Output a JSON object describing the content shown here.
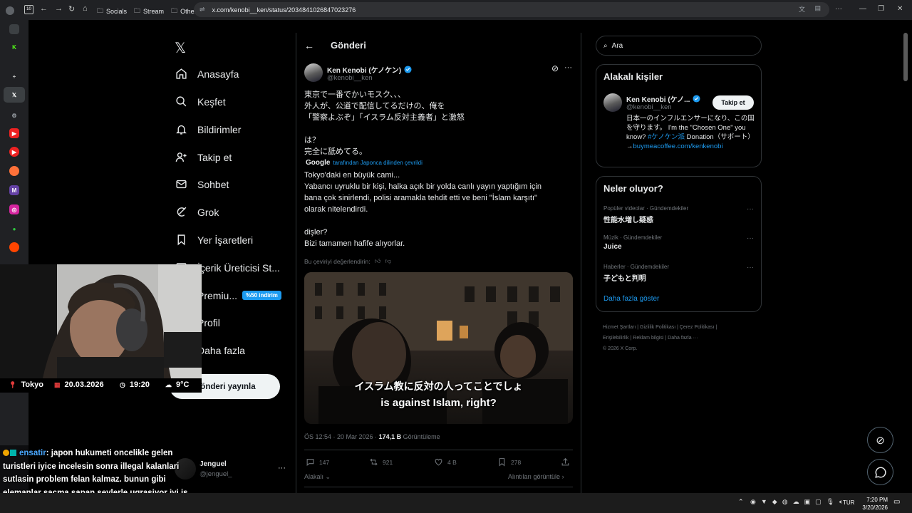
{
  "browser": {
    "tab_count": "10",
    "bookmarks": [
      "Socials",
      "Stream",
      "Others"
    ],
    "url": "x.com/kenobi__ken/status/2034841026847023276"
  },
  "sidebar": {
    "items": [
      {
        "label": "Anasayfa",
        "icon": "home-icon"
      },
      {
        "label": "Keşfet",
        "icon": "search-icon"
      },
      {
        "label": "Bildirimler",
        "icon": "bell-icon"
      },
      {
        "label": "Takip et",
        "icon": "person-add-icon"
      },
      {
        "label": "Sohbet",
        "icon": "mail-icon"
      },
      {
        "label": "Grok",
        "icon": "grok-icon"
      },
      {
        "label": "Yer İşaretleri",
        "icon": "bookmark-icon"
      },
      {
        "label": "İçerik Üreticisi St...",
        "icon": "studio-icon"
      },
      {
        "label": "Premiu...",
        "icon": "premium-icon"
      },
      {
        "label": "Profil",
        "icon": "profile-icon"
      },
      {
        "label": "Daha fazla",
        "icon": "more-icon"
      }
    ],
    "premium_badge": "%50 indirim",
    "post_button": "Gönderi yayınla",
    "account": {
      "name": "Jenguel",
      "handle": "@jenguel_"
    }
  },
  "main": {
    "header_title": "Gönderi",
    "tweet": {
      "author_name": "Ken Kenobi (ケノケン)",
      "author_handle": "@kenobi__ken",
      "original_lines": [
        "東京で一番でかいモスク、、、",
        "外人が、公道で配信してるだけの、俺を",
        "「警察よぶぞ」「イスラム反対主義者」と激怒",
        "",
        "は？",
        "完全に舐めてる。"
      ],
      "translation_provider": "Google",
      "translation_note": "tarafından Japonca dilinden çevrildi",
      "translated_lines": [
        "Tokyo'daki en büyük cami...",
        "Yabancı uyruklu bir kişi, halka açık bir yolda canlı yayın yaptığım için",
        "bana çok sinirlendi, polisi aramakla tehdit etti ve beni \"İslam karşıtı\"",
        "olarak nitelendirdi.",
        "",
        "dişler?",
        "Bizi tamamen hafife alıyorlar."
      ],
      "rate_translation": "Bu çeviriyi değerlendirin:",
      "video_caption_jp": "イスラム教に反対の人ってことでしょ",
      "video_caption_en": "is against Islam, right?",
      "time": "ÖS 12:54 · 20 Mar 2026 · ",
      "views": "174,1 B",
      "views_label": " Görüntüleme",
      "stats": {
        "replies": "147",
        "reposts": "921",
        "likes": "4 B",
        "bookmarks": "278"
      },
      "reply_setting": "Alakalı",
      "quotes_link": "Alıntıları görüntüle"
    }
  },
  "right": {
    "search_placeholder": "Ara",
    "related_title": "Alakalı kişiler",
    "related": {
      "name": "Ken Kenobi (ケノ...",
      "handle": "@kenobi__ken",
      "follow": "Takip et",
      "bio_1": "日本一のインフルエンサーになり、この国を守ります。 I'm the \"Chosen One\" you know? ",
      "bio_hashtag": "#ケノケン派",
      "bio_2": " Donation（サポート）→",
      "bio_link": "buymeacoffee.com/kenkenobi"
    },
    "whats_happening_title": "Neler oluyor?",
    "trends": [
      {
        "category": "Popüler videolar · Gündemdekiler",
        "title": "性能水増し疑惑"
      },
      {
        "category": "Müzik · Gündemdekiler",
        "title": "Juice"
      },
      {
        "category": "Haberler · Gündemdekiler",
        "title": "子どもと判明"
      }
    ],
    "show_more": "Daha fazla göster",
    "footer_line1": "Hizmet Şartları  |  Gizlilik Politikası  |  Çerez Politikası  |",
    "footer_line2": "Erişilebilirlik  |  Reklam bilgisi  |  Daha fazla ···",
    "footer_line3": "© 2026 X Corp."
  },
  "stream_overlay": {
    "location": "Tokyo",
    "date": "20.03.2026",
    "time": "19:20",
    "weather": "9°C",
    "chat_user": "ensatir",
    "chat_message": ": japon hukumeti oncelikle gelen turistleri iyice incelesin sonra illegal kalanlari sutlasin problem felan kalmaz. bunun gibi elemanlar sacma sapan seylerle ugrasiyor iyi is cikti bu tiplere iste"
  },
  "taskbar": {
    "language": "TUR",
    "clock_time": "7:20 PM",
    "clock_date": "3/20/2026"
  },
  "colors": {
    "accent": "#1d9bf0",
    "border": "#2f3336",
    "muted": "#71767b"
  }
}
